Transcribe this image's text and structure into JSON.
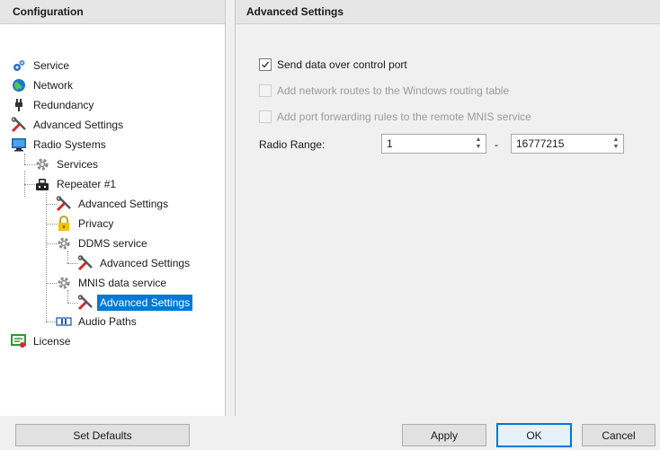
{
  "left_pane": {
    "header": "Configuration",
    "tree": [
      {
        "label": "Service",
        "icon": "gears-icon",
        "level": 0
      },
      {
        "label": "Network",
        "icon": "globe-icon",
        "level": 0
      },
      {
        "label": "Redundancy",
        "icon": "plug-icon",
        "level": 0
      },
      {
        "label": "Advanced Settings",
        "icon": "tools-icon",
        "level": 0
      },
      {
        "label": "Radio Systems",
        "icon": "monitor-icon",
        "level": 0
      },
      {
        "label": "Services",
        "icon": "gear-icon",
        "level": 1
      },
      {
        "label": "Repeater #1",
        "icon": "repeater-icon",
        "level": 1
      },
      {
        "label": "Advanced Settings",
        "icon": "tools-icon",
        "level": 2
      },
      {
        "label": "Privacy",
        "icon": "lock-icon",
        "level": 2
      },
      {
        "label": "DDMS service",
        "icon": "gear-icon",
        "level": 2
      },
      {
        "label": "Advanced Settings",
        "icon": "tools-icon",
        "level": 3
      },
      {
        "label": "MNIS data service",
        "icon": "gear-icon",
        "level": 2
      },
      {
        "label": "Advanced Settings",
        "icon": "tools-icon",
        "level": 3,
        "selected": true
      },
      {
        "label": "Audio Paths",
        "icon": "audio-path-icon",
        "level": 2
      },
      {
        "label": "License",
        "icon": "license-icon",
        "level": 0
      }
    ]
  },
  "right_pane": {
    "header": "Advanced Settings",
    "options": [
      {
        "label": "Send data over control port",
        "checked": true,
        "enabled": true
      },
      {
        "label": "Add network routes to the Windows routing table",
        "checked": false,
        "enabled": false
      },
      {
        "label": "Add port forwarding rules to the remote MNIS service",
        "checked": false,
        "enabled": false
      }
    ],
    "radio_range": {
      "label": "Radio Range:",
      "from": "1",
      "separator": "-",
      "to": "16777215"
    }
  },
  "buttons": {
    "set_defaults": "Set Defaults",
    "apply": "Apply",
    "ok": "OK",
    "cancel": "Cancel"
  },
  "colors": {
    "selection": "#0078d7",
    "header_bg": "#e6e6e6"
  }
}
